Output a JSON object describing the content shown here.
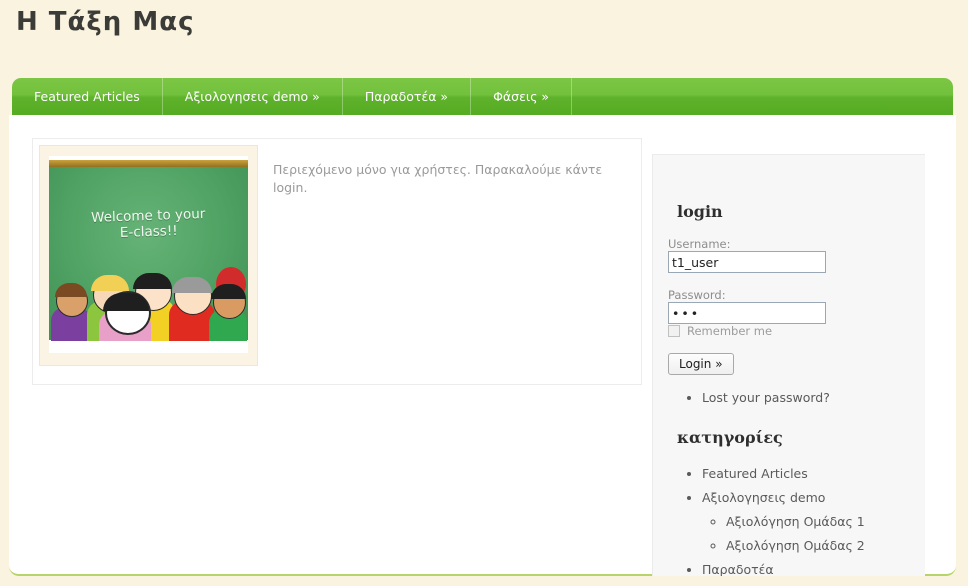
{
  "header": {
    "site_title": "Η Τάξη Μας"
  },
  "nav": {
    "items": [
      {
        "label": "Featured Articles"
      },
      {
        "label": "Αξιολογησεις demo »"
      },
      {
        "label": "Παραδοτέα »"
      },
      {
        "label": "Φάσεις »"
      }
    ]
  },
  "main": {
    "article": {
      "thumbnail": {
        "alt": "welcome-chalkboard-image",
        "board_line1": "Welcome to your",
        "board_line2": "E-class!!"
      },
      "body_text": "Περιεχόμενο μόνο για χρήστες. Παρακαλούμε κάντε login."
    }
  },
  "sidebar": {
    "login": {
      "title": "login",
      "username_label": "Username:",
      "username_value": "t1_user",
      "password_label": "Password:",
      "password_value": "•••",
      "remember_label": "Remember me",
      "submit_label": "Login »",
      "lost_password_label": "Lost your password?"
    },
    "categories": {
      "title": "κατηγορίες",
      "items": [
        {
          "label": "Featured Articles",
          "children": []
        },
        {
          "label": "Αξιολογησεις demo",
          "children": [
            {
              "label": "Αξιολόγηση Ομάδας 1"
            },
            {
              "label": "Αξιολόγηση Ομάδας 2"
            }
          ]
        },
        {
          "label": "Παραδοτέα",
          "children": []
        }
      ]
    }
  },
  "colors": {
    "page_background": "#faf3e0",
    "nav_green_top": "#7cc644",
    "nav_green_bottom": "#55ab22",
    "content_white": "#ffffff",
    "sidebar_gray": "#f7f7f7",
    "title_text": "#3b3b38",
    "muted_text": "#9a9a9a",
    "bottom_rule_green": "#b6d46a"
  }
}
